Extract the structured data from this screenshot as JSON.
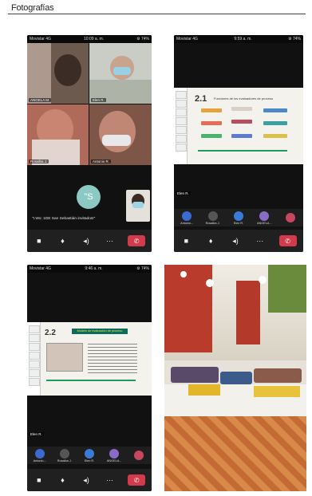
{
  "document": {
    "title": "Fotografías"
  },
  "shot1": {
    "status": {
      "carrier": "Movistar 4G",
      "time": "10:09 a. m.",
      "right": "⚙ 74%"
    },
    "tiles": [
      {
        "name": "ANGELA M."
      },
      {
        "name": "Elen R."
      },
      {
        "name": "Rosalba J."
      },
      {
        "name": "Antonio R."
      }
    ],
    "avatar_initials": "\"S",
    "caption": "\"I.Wo: 1DE San Sebastián invitados!\""
  },
  "shot2": {
    "status": {
      "carrier": "Movistar 4G",
      "time": "9:59 a. m.",
      "right": "⚙ 74%"
    },
    "slide_number": "2.1",
    "slide_heading": "Funciones de los evaluadores de proceso",
    "presenter": "Elen R.",
    "participants": [
      {
        "initials": "EM",
        "label": "Antonio...",
        "color": "#3b6bd0"
      },
      {
        "initials": "",
        "label": "Rosalba J.",
        "color": "#555555"
      },
      {
        "initials": "EH",
        "label": "Elen R.",
        "color": "#3a7bd5"
      },
      {
        "initials": "AM",
        "label": "ANGELA...",
        "color": "#8a6bc7"
      },
      {
        "initials": "+",
        "label": "",
        "color": "#c7475f"
      }
    ]
  },
  "shot3": {
    "status": {
      "carrier": "Movistar 4G",
      "time": "9:46 a. m.",
      "right": "⚙ 74%"
    },
    "slide_number": "2.2",
    "slide_heading": "Modelo de evaluación de proceso",
    "presenter": "Elen R.",
    "participants": [
      {
        "initials": "EM",
        "label": "Antonio...",
        "color": "#3b6bd0"
      },
      {
        "initials": "",
        "label": "Rosalba J.",
        "color": "#555555"
      },
      {
        "initials": "EH",
        "label": "Elen R.",
        "color": "#3a7bd5"
      },
      {
        "initials": "AM",
        "label": "ANGELA...",
        "color": "#8a6bc7"
      },
      {
        "initials": "+",
        "label": "",
        "color": "#c7475f"
      }
    ]
  },
  "colors": {
    "hangup": "#d33a4b",
    "accent": "#8cc9c4",
    "slide_green": "#0c6b5a"
  },
  "icons": [
    "video-icon",
    "mic-icon",
    "speaker-icon",
    "more-icon",
    "hangup-icon"
  ]
}
